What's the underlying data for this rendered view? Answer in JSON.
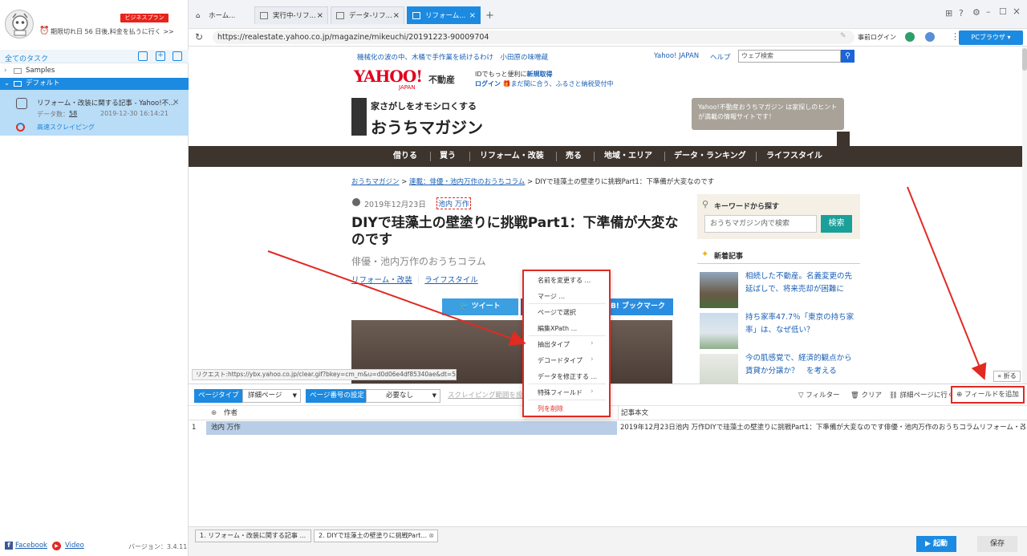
{
  "sidebar": {
    "plan_badge": "ビジネスプラン",
    "expiry_text": "期限切れ日 56 日後,料金を払うに行く >>",
    "all_tasks_label": "全てのタスク",
    "tree": [
      {
        "label": "Samples"
      },
      {
        "label": "デフォルト"
      }
    ],
    "task": {
      "title": "リフォーム・改装に関する記事 - Yahoo!不...",
      "data_count_label": "データ数：",
      "data_count": "58",
      "date": "2019-12-30 16:14:21",
      "mode": "高速スクレイピング"
    },
    "footer": {
      "facebook": "Facebook",
      "video": "Video",
      "version": "バージョン：3.4.11"
    }
  },
  "browser": {
    "tabs": [
      {
        "label": "ホーム..."
      },
      {
        "label": "実行中-リフ..."
      },
      {
        "label": "データ-リフ..."
      },
      {
        "label": "リフォーム..."
      }
    ],
    "url": "https://realestate.yahoo.co.jp/magazine/mikeuchi/20191223-90009704",
    "login_label": "事前ログイン",
    "pc_browser": "PCブラウザ"
  },
  "site": {
    "top_notice": "機械化の波の中、木桶で手作業を続けるわけ　小田原の味噌蔵",
    "yahoo_japan": "Yahoo! JAPAN",
    "help": "ヘルプ",
    "search_placeholder": "ウェブ検索",
    "logo_text": "YAHOO!",
    "logo_sub": "JAPAN",
    "logo_suffix": "不動産",
    "id_notice_1": "IDでもっと便利に",
    "id_register": "新規取得",
    "login_link": "ログイン",
    "furusato": "まだ間に合う、ふるさと納税受付中",
    "brand_tagline": "家さがしをオモシロくする",
    "brand_name": "おうちマガジン",
    "tooltip": "Yahoo!不動産おうちマガジン は家探しのヒントが満載の情報サイトです！",
    "nav": [
      "借りる",
      "買う",
      "リフォーム・改装",
      "売る",
      "地域・エリア",
      "データ・ランキング",
      "ライフスタイル"
    ],
    "breadcrumb": [
      "おうちマガジン",
      "連載：俳優・池内万作のおうちコラム",
      "DIYで珪藻土の壁塗りに挑戦Part1：下準備が大変なのです"
    ],
    "article": {
      "date": "2019年12月23日",
      "author_tag": "池内 万作",
      "title": "DIYで珪藻土の壁塗りに挑戦Part1：下準備が大変なのです",
      "subtitle": "俳優・池内万作のおうちコラム",
      "category1": "リフォーム・改装",
      "category2": "ライフスタイル",
      "tweet": "ツイート",
      "bookmark": "ブックマーク"
    },
    "keyword_title": "キーワードから探す",
    "keyword_placeholder": "おうちマガジン内で検索",
    "keyword_btn": "検索",
    "new_title": "新着記事",
    "news": [
      {
        "title": "相続した不動産。名義変更の先延ばしで、将来売却が困難に"
      },
      {
        "title": "持ち家率47.7％「東京の持ち家率」は、なぜ低い？"
      },
      {
        "title": "今の肌感覚で、経済的観点から賃貸か分譲か？　を考える"
      }
    ],
    "request_status": "リクエスト:https://ybx.yahoo.co.jp/clear.gif?bkey=cm_m&u=d0d06e4df85340ae&dt=5...",
    "fold": "折る"
  },
  "context_menu": {
    "items": [
      {
        "label": "名前を変更する ..."
      },
      {
        "label": "マージ ..."
      },
      {
        "label": "ページで選択"
      },
      {
        "label": "編集XPath ..."
      },
      {
        "label": "抽出タイプ"
      },
      {
        "label": "デコードタイプ"
      },
      {
        "label": "データを修正する ..."
      },
      {
        "label": "特殊フィールド"
      },
      {
        "label": "列を削除"
      }
    ]
  },
  "toolbar": {
    "page_type_label": "ページタイプ",
    "page_type_value": "詳細ページ",
    "page_num_label": "ページ番号の設定",
    "page_num_value": "必要なし",
    "scrape_range": "スクレイピング範囲を設定",
    "filter": "フィルター",
    "clear": "クリア",
    "detail": "詳細ページに行く",
    "add_field": "フィールドを追加"
  },
  "grid": {
    "columns": [
      "作者",
      "記事本文"
    ],
    "rows": [
      {
        "num": "1",
        "author": "池内 万作",
        "body": "2019年12月23日池内 万作DIYで珪藻土の壁塗りに挑戦Part1：下準備が大変なのです俳優・池内万作のおうちコラムリフォーム・改装ライ..."
      }
    ]
  },
  "bottom": {
    "tabs": [
      {
        "label": "1. リフォーム・改装に関する記事 ..."
      },
      {
        "label": "2. DIYで珪藻土の壁塗りに挑戦Part..."
      }
    ],
    "launch": "起動",
    "save": "保存"
  },
  "colors": {
    "accent": "#1c8ae0",
    "highlight_red": "#e12a22",
    "nav_bg": "#3c342d",
    "selected_task": "#b9dcf7"
  }
}
